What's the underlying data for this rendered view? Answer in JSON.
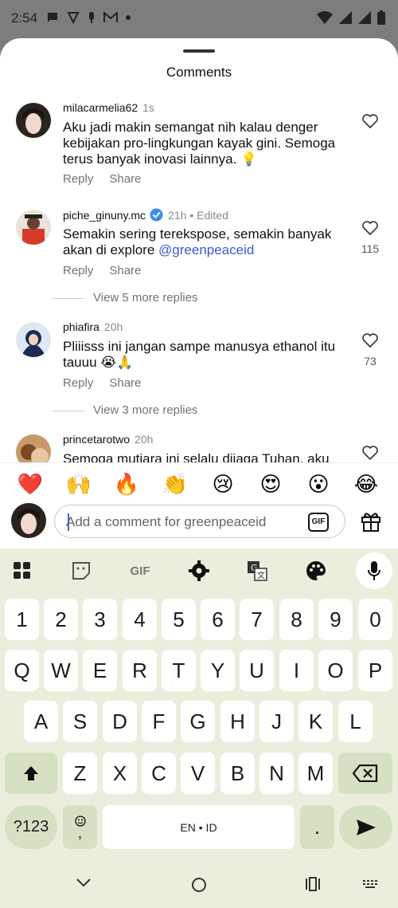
{
  "status_bar": {
    "time": "2:54",
    "icons_left": [
      "chat-icon",
      "shield-icon",
      "mic-small-icon",
      "gmail-icon",
      "dot-icon"
    ],
    "icons_right": [
      "wifi-icon",
      "signal-icon",
      "signal-icon",
      "battery-icon"
    ]
  },
  "sheet": {
    "title": "Comments"
  },
  "comments": [
    {
      "username": "milacarmelia62",
      "time": "1s",
      "edited": "",
      "text": "Aku jadi makin semangat nih kalau denger kebijakan pro-lingkungan kayak gini. Semoga terus banyak inovasi lainnya. 💡",
      "reply": "Reply",
      "share": "Share",
      "likes": ""
    },
    {
      "username": "piche_ginuny.mc",
      "verified": true,
      "time": "21h",
      "edited": "• Edited",
      "text": "Semakin sering terekspose, semakin banyak akan di explore ",
      "mention": "@greenpeaceid",
      "reply": "Reply",
      "share": "Share",
      "likes": "115",
      "more_replies": "View 5 more replies"
    },
    {
      "username": "phiafira",
      "time": "20h",
      "edited": "",
      "text": "Pliiisss ini jangan sampe manusya ethanol itu tauuu 😭🙏",
      "reply": "Reply",
      "share": "Share",
      "likes": "73",
      "more_replies": "View 3 more replies"
    },
    {
      "username": "princetarotwo",
      "time": "20h",
      "text": "Semoga mutiara ini selalu dijaga Tuhan, aku"
    }
  ],
  "emoji_reactions": [
    "❤️",
    "🙌",
    "🔥",
    "👏",
    "😢",
    "😍",
    "😮",
    "😂"
  ],
  "composer": {
    "placeholder": "Add a comment for greenpeaceid",
    "gif_label": "GIF"
  },
  "keyboard": {
    "toolbar": [
      "apps-icon",
      "sticker-icon",
      "gif-icon",
      "settings-icon",
      "translate-icon",
      "palette-icon",
      "mic-icon"
    ],
    "toolbar_gif": "GIF",
    "row_numbers": [
      "1",
      "2",
      "3",
      "4",
      "5",
      "6",
      "7",
      "8",
      "9",
      "0"
    ],
    "row1": [
      "Q",
      "W",
      "E",
      "R",
      "T",
      "Y",
      "U",
      "I",
      "O",
      "P"
    ],
    "row2": [
      "A",
      "S",
      "D",
      "F",
      "G",
      "H",
      "J",
      "K",
      "L"
    ],
    "row3": [
      "Z",
      "X",
      "C",
      "V",
      "B",
      "N",
      "M"
    ],
    "symbols_label": "?123",
    "emoji_comma": ",",
    "space_label": "EN • ID",
    "period": "."
  },
  "colors": {
    "mention": "#3b5ad1",
    "keyboard_bg": "#eceedd",
    "function_key": "#d5e1c2",
    "verified": "#3b8cf0"
  }
}
